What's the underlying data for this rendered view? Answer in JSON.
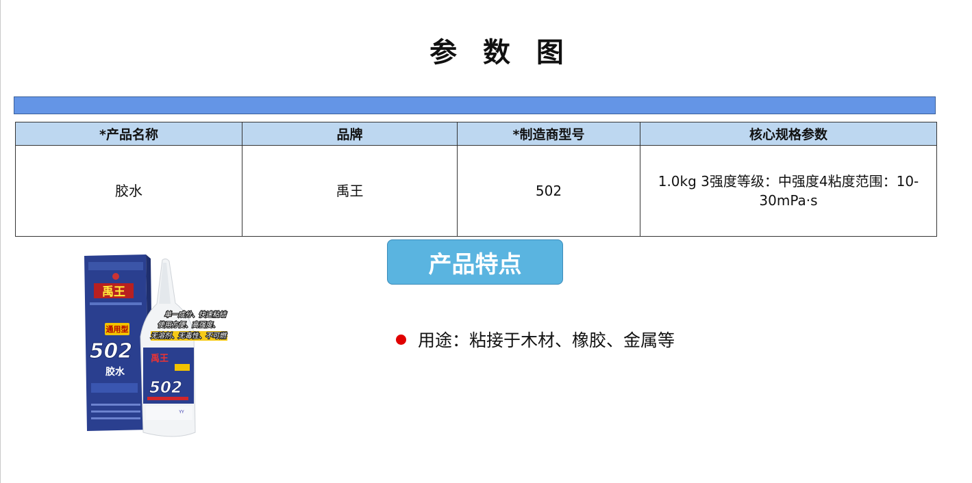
{
  "page": {
    "title": "参 数 图"
  },
  "spec_table": {
    "headers": [
      "*产品名称",
      "品牌",
      "*制造商型号",
      "核心规格参数"
    ],
    "row": [
      "胶水",
      "禹王",
      "502",
      "1.0kg  3强度等级：中强度4粘度范围：10-30mPa·s"
    ]
  },
  "features": {
    "heading": "产品特点",
    "items": [
      "用途：粘接于木材、橡胶、金属等"
    ]
  },
  "product_image": {
    "box_brand": "禹王",
    "box_model": "502",
    "box_name": "胶水",
    "box_tag": "通用型",
    "bottle_brand": "禹王",
    "bottle_model": "502",
    "promo_lines": [
      "单一成分、快速粘结",
      "使用方便、高强度、",
      "无溶剂、无毒性、不可燃"
    ]
  },
  "colors": {
    "bar": "#6495e6",
    "table_header": "#bdd7f0",
    "badge": "#5ab4e0",
    "bullet": "#e00000"
  }
}
